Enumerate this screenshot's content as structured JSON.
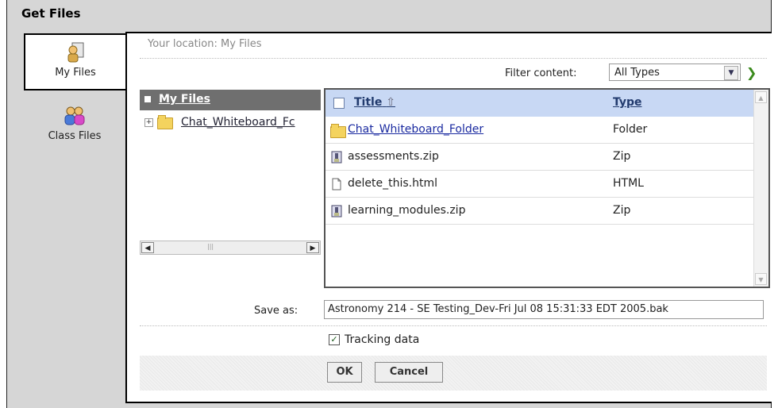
{
  "window": {
    "title": "Get Files"
  },
  "tabs": [
    {
      "label": "My Files",
      "icon": "my-files-icon"
    },
    {
      "label": "Class Files",
      "icon": "class-files-icon"
    }
  ],
  "location": {
    "text": "Your location: My Files"
  },
  "filter": {
    "label": "Filter content:",
    "selected": "All Types"
  },
  "tree": {
    "root": "My Files",
    "items": [
      {
        "label": "Chat_Whiteboard_Fc"
      }
    ]
  },
  "list": {
    "columns": {
      "title": "Title",
      "type": "Type"
    },
    "rows": [
      {
        "name": "Chat_Whiteboard_Folder",
        "type": "Folder",
        "icon": "folder-icon"
      },
      {
        "name": "assessments.zip",
        "type": "Zip",
        "icon": "zip-icon"
      },
      {
        "name": "delete_this.html",
        "type": "HTML",
        "icon": "file-icon"
      },
      {
        "name": "learning_modules.zip",
        "type": "Zip",
        "icon": "zip-icon"
      }
    ]
  },
  "save_as": {
    "label": "Save as:",
    "value": "Astronomy 214 - SE Testing_Dev-Fri Jul 08 15:31:33 EDT 2005.bak"
  },
  "tracking": {
    "label": "Tracking data",
    "checked": true
  },
  "buttons": {
    "ok": "OK",
    "cancel": "Cancel"
  }
}
